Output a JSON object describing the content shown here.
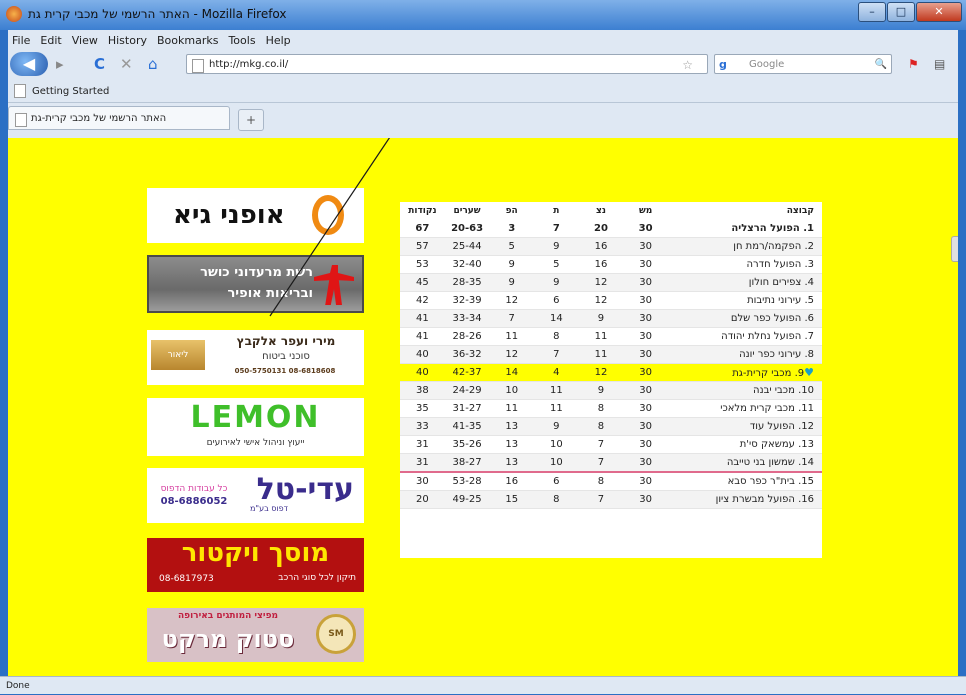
{
  "window": {
    "title": "האתר הרשמי של מכבי קרית גת - Mozilla Firefox",
    "min": "–",
    "max": "□",
    "close": "✕"
  },
  "menu": [
    "File",
    "Edit",
    "View",
    "History",
    "Bookmarks",
    "Tools",
    "Help"
  ],
  "nav": {
    "back": "◀",
    "forward": "▸",
    "reload": "C",
    "stop": "✕",
    "home": "⌂",
    "url": "http://mkg.co.il/",
    "star": "☆",
    "search_placeholder": "Google",
    "search_go": "🔍",
    "addon": "⚑",
    "extra": "▤"
  },
  "bookmarks": {
    "item": "Getting Started"
  },
  "tab": {
    "title": "האתר הרשמי של מכבי קרית-גת",
    "new_tab": "+"
  },
  "ads": {
    "openi": "אופני גיא",
    "restaurants": {
      "line1": "רשת מרעדוני כושר",
      "line2": "ובריאות אופיר"
    },
    "miri": {
      "line1": "מירי ועפר אלקבץ",
      "line2": "סוכני ביטוח",
      "phones": "050-5750131   08-6818608",
      "logo": "ליאור"
    },
    "lemon": {
      "big": "LEMON",
      "sub": "ייעוץ וניהול אישי לאירועים"
    },
    "dital": {
      "big": "עדי-טל",
      "line1": "כל עבודות הדפוס",
      "phone": "08-6886052",
      "sub": "דפוס בע\"מ"
    },
    "victor": {
      "big": "מוסך ויקטור",
      "phone": "08-6817973",
      "sub": "תיקון לכל סוגי הרכב"
    },
    "stock": {
      "line1": "מפיצי המותגים באירופה",
      "big": "סטוק מרקט",
      "seal": "SM"
    }
  },
  "league": {
    "headers": {
      "team": "קבוצה",
      "played": "מש",
      "wins": "נצ",
      "draws": "ת",
      "losses": "הפ",
      "goals": "שערים",
      "points": "נקודות"
    },
    "rows": [
      {
        "pos": "1.",
        "team": "הפועל הרצליה",
        "played": "30",
        "wins": "20",
        "draws": "7",
        "losses": "3",
        "goals": "20-63",
        "points": "67"
      },
      {
        "pos": "2.",
        "team": "הפקמה/רמת חן",
        "played": "30",
        "wins": "16",
        "draws": "9",
        "losses": "5",
        "goals": "25-44",
        "points": "57"
      },
      {
        "pos": "3.",
        "team": "הפועל חדרה",
        "played": "30",
        "wins": "16",
        "draws": "5",
        "losses": "9",
        "goals": "32-40",
        "points": "53"
      },
      {
        "pos": "4.",
        "team": "צפירים חולון",
        "played": "30",
        "wins": "12",
        "draws": "9",
        "losses": "9",
        "goals": "28-35",
        "points": "45"
      },
      {
        "pos": "5.",
        "team": "עירוני נתיבות",
        "played": "30",
        "wins": "12",
        "draws": "6",
        "losses": "12",
        "goals": "32-39",
        "points": "42"
      },
      {
        "pos": "6.",
        "team": "הפועל כפר שלם",
        "played": "30",
        "wins": "9",
        "draws": "14",
        "losses": "7",
        "goals": "33-34",
        "points": "41"
      },
      {
        "pos": "7.",
        "team": "הפועל נחלת יהודה",
        "played": "30",
        "wins": "11",
        "draws": "8",
        "losses": "11",
        "goals": "28-26",
        "points": "41"
      },
      {
        "pos": "8.",
        "team": "עירוני כפר יונה",
        "played": "30",
        "wins": "11",
        "draws": "7",
        "losses": "12",
        "goals": "36-32",
        "points": "40"
      },
      {
        "pos": "9.",
        "team": "מכבי קרית-גת",
        "played": "30",
        "wins": "12",
        "draws": "4",
        "losses": "14",
        "goals": "42-37",
        "points": "40",
        "marker": "♥"
      },
      {
        "pos": "10.",
        "team": "מכבי יבנה",
        "played": "30",
        "wins": "9",
        "draws": "11",
        "losses": "10",
        "goals": "24-29",
        "points": "38"
      },
      {
        "pos": "11.",
        "team": "מכבי קרית מלאכי",
        "played": "30",
        "wins": "8",
        "draws": "11",
        "losses": "11",
        "goals": "31-27",
        "points": "35"
      },
      {
        "pos": "12.",
        "team": "הפועל עוד",
        "played": "30",
        "wins": "8",
        "draws": "9",
        "losses": "13",
        "goals": "41-35",
        "points": "33"
      },
      {
        "pos": "13.",
        "team": "עמשאק סי'ת",
        "played": "30",
        "wins": "7",
        "draws": "10",
        "losses": "13",
        "goals": "35-26",
        "points": "31"
      },
      {
        "pos": "14.",
        "team": "שמשון בני טייבה",
        "played": "30",
        "wins": "7",
        "draws": "10",
        "losses": "13",
        "goals": "38-27",
        "points": "31"
      },
      {
        "pos": "15.",
        "team": "בית\"ר כפר סבא",
        "played": "30",
        "wins": "8",
        "draws": "6",
        "losses": "16",
        "goals": "53-28",
        "points": "30"
      },
      {
        "pos": "16.",
        "team": "הפועל מבשרת ציון",
        "played": "30",
        "wins": "7",
        "draws": "8",
        "losses": "15",
        "goals": "49-25",
        "points": "20"
      }
    ]
  },
  "status": {
    "text": "Done"
  }
}
